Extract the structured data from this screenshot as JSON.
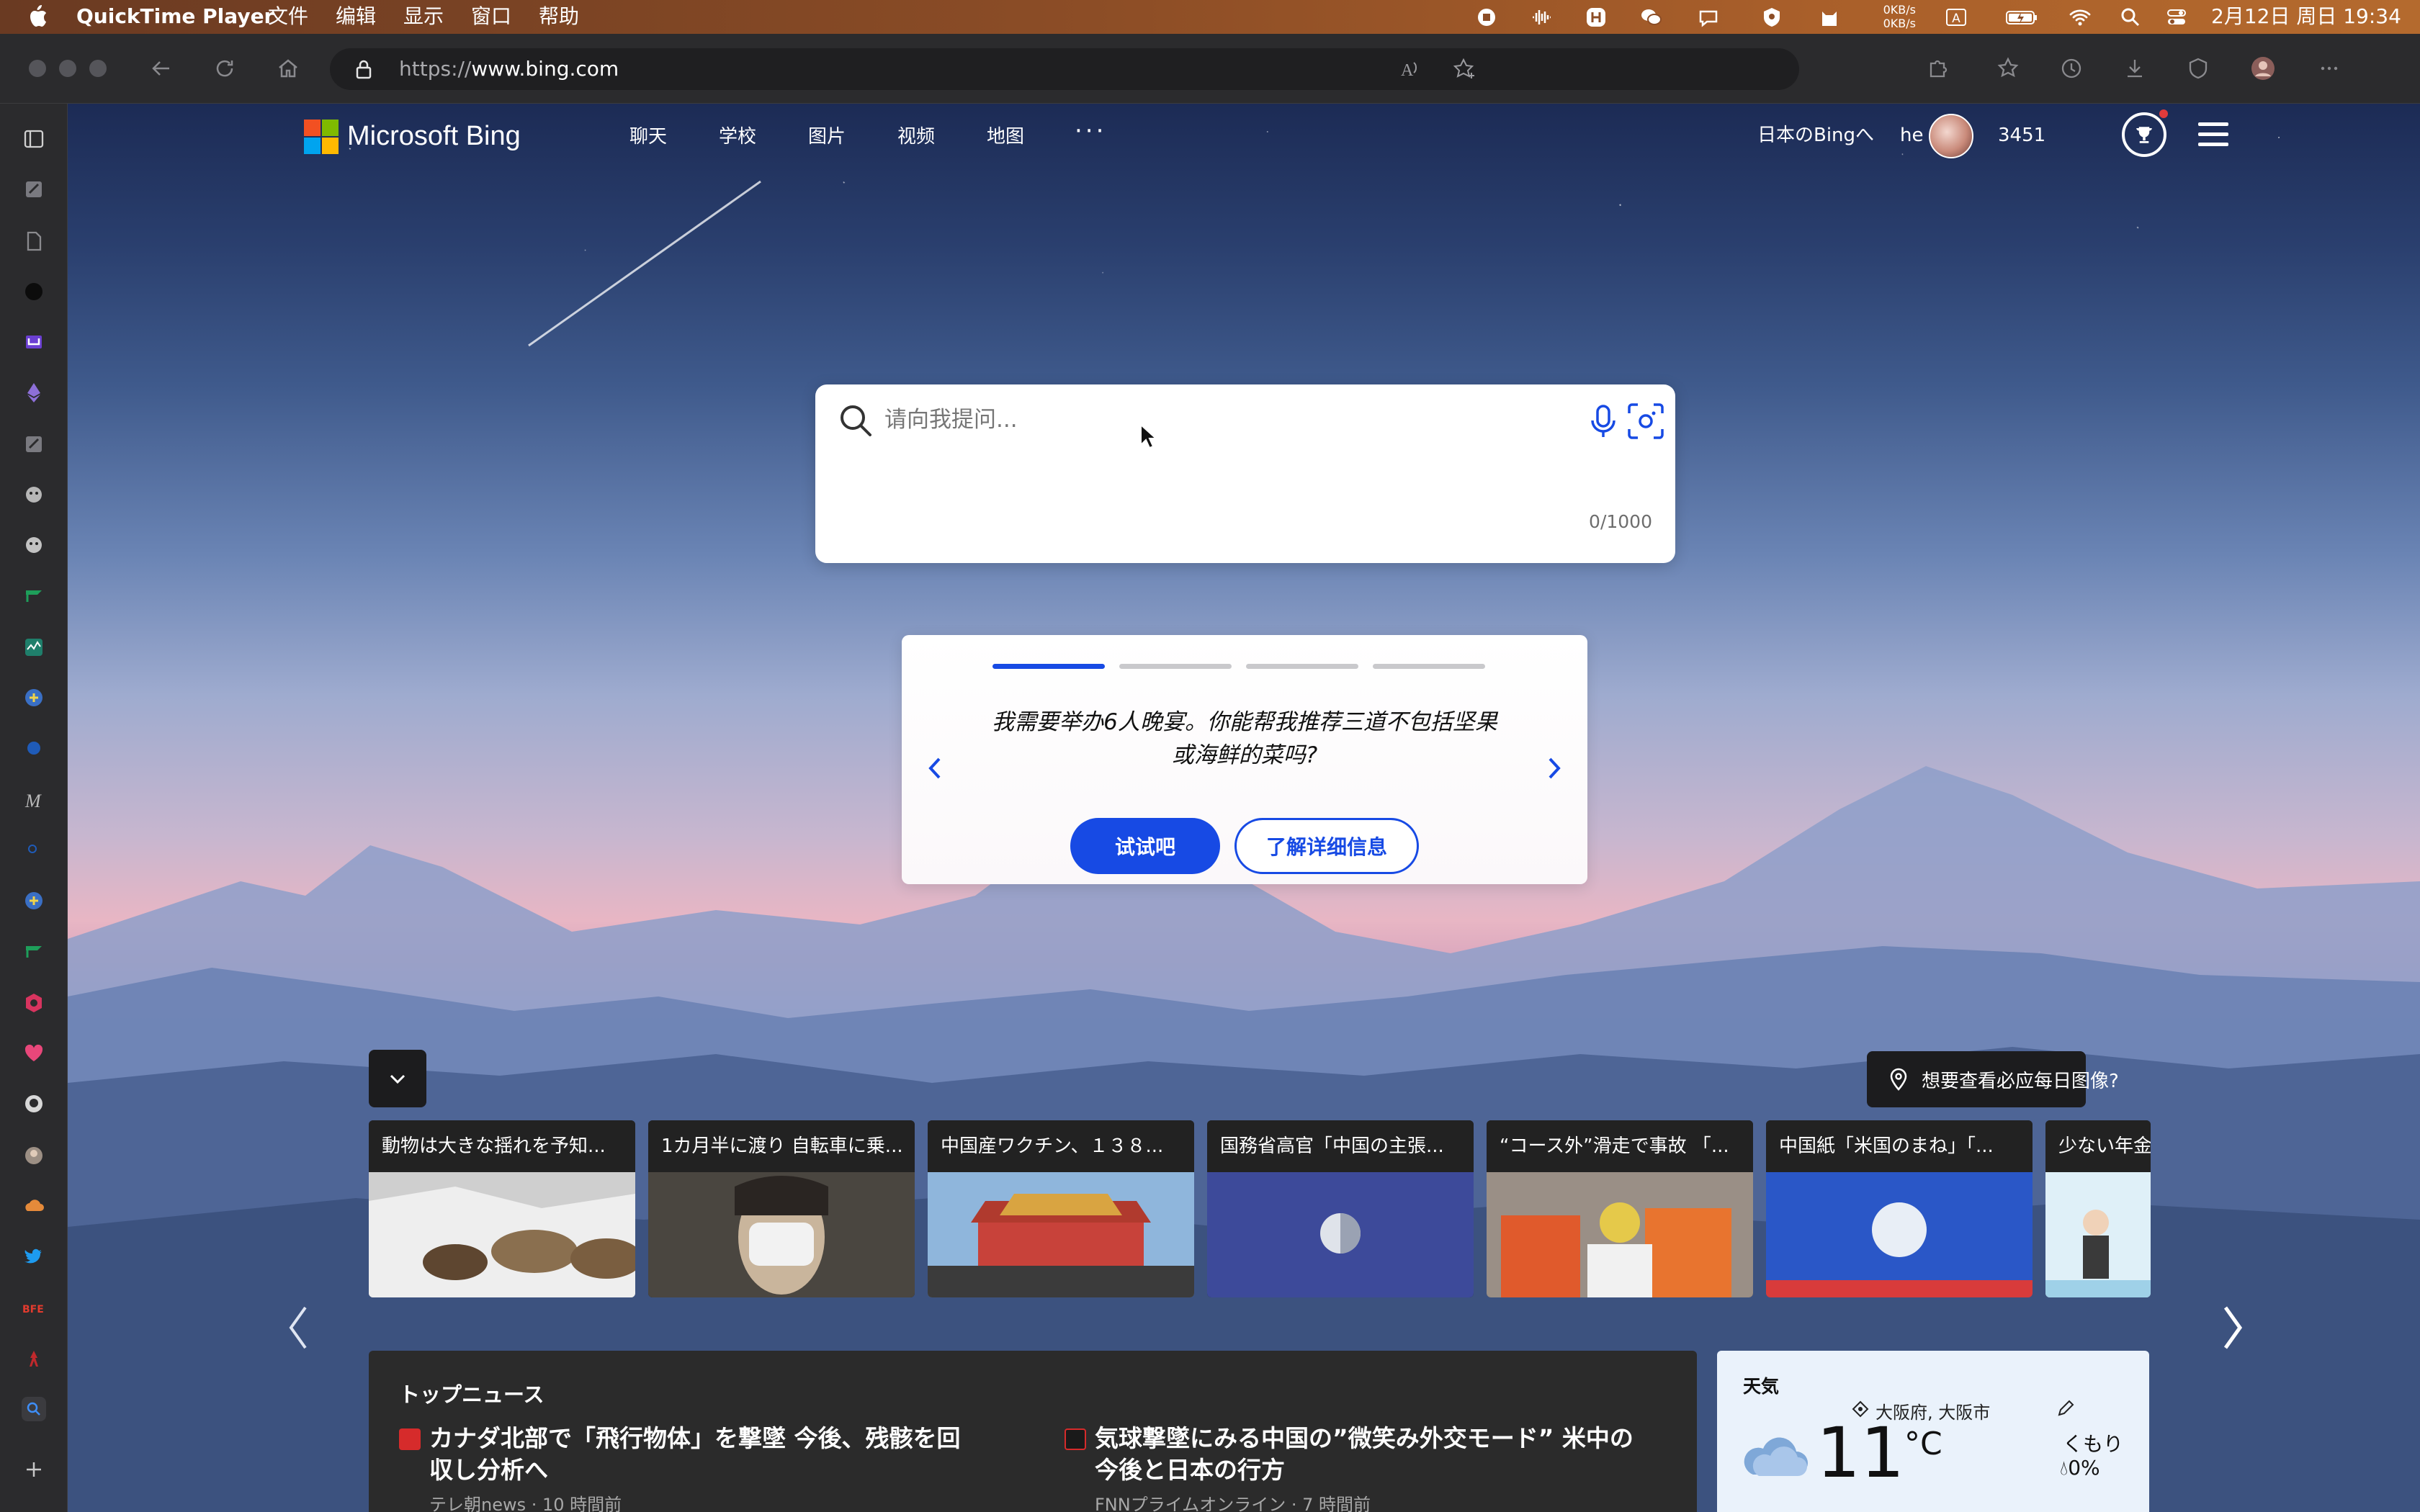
{
  "menubar": {
    "app_name": "QuickTime Player",
    "menus": [
      "文件",
      "编辑",
      "显示",
      "窗口",
      "帮助"
    ],
    "net_up": "0KB/s",
    "net_down": "0KB/s",
    "input_method": "A",
    "clock": "2月12日 周日 19:34"
  },
  "browser": {
    "url_scheme": "https://",
    "url_host": "www.bing.com"
  },
  "bing": {
    "logo_text": "Microsoft Bing",
    "nav": [
      "聊天",
      "学校",
      "图片",
      "视频",
      "地图"
    ],
    "nav_more": "···",
    "region_link": "日本のBingへ",
    "user_name": "he",
    "reward_points": "3451",
    "logo_colors": [
      "#f25022",
      "#7fba00",
      "#00a4ef",
      "#ffb900"
    ]
  },
  "search": {
    "placeholder": "请向我提问...",
    "value": "",
    "counter": "0/1000"
  },
  "copilot": {
    "active_step": 1,
    "total_steps": 4,
    "prompt": "我需要举办6人晚宴。你能帮我推荐三道不包括坚果或海鲜的菜吗?",
    "try_button": "试试吧",
    "learn_button": "了解详细信息",
    "accent_color": "#174ae4"
  },
  "image_info": {
    "location_question": "想要查看必应每日图像?"
  },
  "news_carousel": [
    {
      "title": "動物は大きな揺れを予知..."
    },
    {
      "title": "1カ月半に渡り 自転車に乗..."
    },
    {
      "title": "中国産ワクチン、１３８..."
    },
    {
      "title": "国務省高官「中国の主張..."
    },
    {
      "title": "“コース外”滑走で事故 「..."
    },
    {
      "title": "中国紙「米国のまね」「..."
    },
    {
      "title": "少ない年金..."
    }
  ],
  "top_news": {
    "heading": "トップニュース",
    "items": [
      {
        "headline": "カナダ北部で「飛行物体」を撃墜 今後、残骸を回収し分析へ",
        "meta": "テレ朝news · 10 時間前"
      },
      {
        "headline": "気球撃墜にみる中国の”微笑み外交モード” 米中の今後と日本の行方",
        "meta": "FNNプライムオンライン · 7 時間前"
      }
    ]
  },
  "weather": {
    "title": "天気",
    "location": "大阪府, 大阪市",
    "temperature": "11",
    "unit": "°C",
    "condition": "くもり",
    "precipitation": "0%"
  }
}
